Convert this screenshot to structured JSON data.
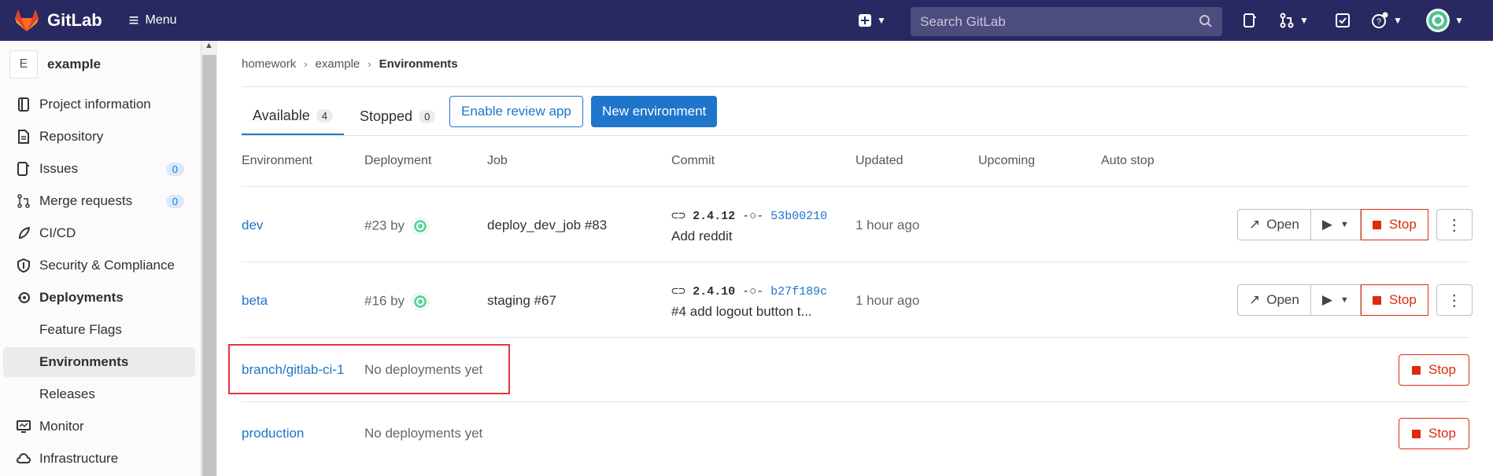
{
  "topbar": {
    "brand": "GitLab",
    "menu_label": "Menu",
    "search_placeholder": "Search GitLab",
    "icons": [
      "gitlab-logo",
      "plus-square-icon",
      "search-icon",
      "issues-icon",
      "merge-request-icon",
      "todo-icon",
      "help-icon",
      "avatar"
    ]
  },
  "sidebar": {
    "project_initial": "E",
    "project_name": "example",
    "items": [
      {
        "label": "Project information",
        "icon": "info-icon"
      },
      {
        "label": "Repository",
        "icon": "document-icon"
      },
      {
        "label": "Issues",
        "icon": "issues-icon",
        "count": "0"
      },
      {
        "label": "Merge requests",
        "icon": "merge-request-icon",
        "count": "0"
      },
      {
        "label": "CI/CD",
        "icon": "rocket-icon"
      },
      {
        "label": "Security & Compliance",
        "icon": "shield-icon"
      },
      {
        "label": "Deployments",
        "icon": "deployments-icon"
      },
      {
        "label": "Feature Flags"
      },
      {
        "label": "Environments"
      },
      {
        "label": "Releases"
      },
      {
        "label": "Monitor",
        "icon": "monitor-icon"
      },
      {
        "label": "Infrastructure",
        "icon": "cloud-icon"
      }
    ]
  },
  "breadcrumb": [
    "homework",
    "example",
    "Environments"
  ],
  "tabs": [
    {
      "label": "Available",
      "count": "4"
    },
    {
      "label": "Stopped",
      "count": "0"
    }
  ],
  "buttons": {
    "review_app": "Enable review app",
    "new_env": "New environment",
    "open": "Open",
    "stop": "Stop"
  },
  "columns": [
    "Environment",
    "Deployment",
    "Job",
    "Commit",
    "Updated",
    "Upcoming",
    "Auto stop"
  ],
  "rows": [
    {
      "env": "dev",
      "deployment": "#23 by",
      "job": "deploy_dev_job #83",
      "tag": "2.4.12",
      "sha": "53b00210",
      "message": "Add reddit",
      "updated": "1 hour ago"
    },
    {
      "env": "beta",
      "deployment": "#16 by",
      "job": "staging #67",
      "tag": "2.4.10",
      "sha": "b27f189c",
      "message": "#4 add logout button t...",
      "updated": "1 hour ago"
    },
    {
      "env": "branch/gitlab-ci-1",
      "deployment": "No deployments yet"
    },
    {
      "env": "production",
      "deployment": "No deployments yet"
    }
  ],
  "colors": {
    "topbar": "#292961",
    "link": "#1f75cb",
    "danger": "#dd2b0e",
    "highlight": "#e2353b"
  }
}
